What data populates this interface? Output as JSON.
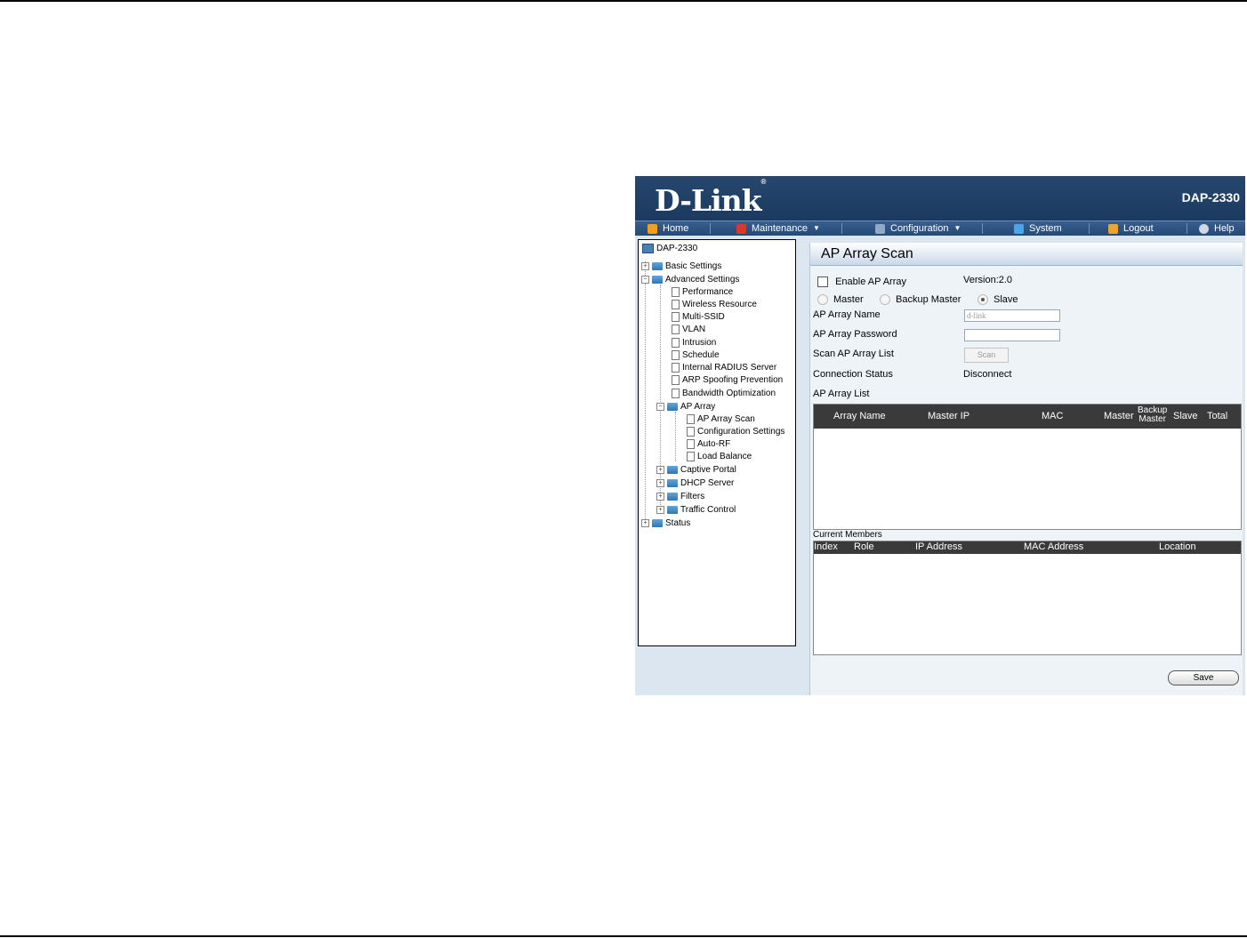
{
  "brand": {
    "logo": "D-Link",
    "trademark": "®",
    "model": "DAP-2330"
  },
  "nav": {
    "home": "Home",
    "maintenance": "Maintenance",
    "configuration": "Configuration",
    "system": "System",
    "logout": "Logout",
    "help": "Help"
  },
  "tree": {
    "root": "DAP-2330",
    "basic": "Basic Settings",
    "advanced": "Advanced Settings",
    "items": [
      "Performance",
      "Wireless Resource",
      "Multi-SSID",
      "VLAN",
      "Intrusion",
      "Schedule",
      "Internal RADIUS Server",
      "ARP Spoofing Prevention",
      "Bandwidth Optimization"
    ],
    "ap_array": "AP Array",
    "ap_array_items": [
      "AP Array Scan",
      "Configuration Settings",
      "Auto-RF",
      "Load Balance"
    ],
    "captive": "Captive Portal",
    "dhcp": "DHCP Server",
    "filters": "Filters",
    "traffic": "Traffic Control",
    "status": "Status"
  },
  "panel": {
    "title": "AP Array Scan",
    "enable_label": "Enable AP Array",
    "version": "Version:2.0",
    "roles": [
      "Master",
      "Backup Master",
      "Slave"
    ],
    "selected_role": "Slave",
    "name_label": "AP Array Name",
    "name_value": "d-link",
    "password_label": "AP Array Password",
    "scan_label": "Scan AP Array List",
    "scan_button": "Scan",
    "conn_label": "Connection Status",
    "conn_value": "Disconnect",
    "list_label": "AP Array List",
    "list_headers": {
      "array_name": "Array Name",
      "master_ip": "Master IP",
      "mac": "MAC",
      "master": "Master",
      "backup_line1": "Backup",
      "backup_line2": "Master",
      "slave": "Slave",
      "total": "Total"
    },
    "members_label": "Current Members",
    "members_headers": [
      "Index",
      "Role",
      "IP Address",
      "MAC Address",
      "Location"
    ],
    "save": "Save"
  }
}
